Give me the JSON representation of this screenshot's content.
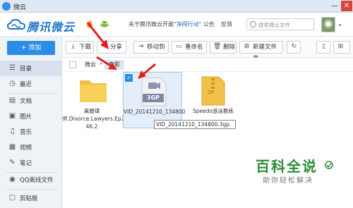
{
  "window": {
    "title": "微云",
    "minimize": "—",
    "close": "✕"
  },
  "header": {
    "logo_text": "腾讯微云",
    "notice_prefix": "关于腾讯微云开展",
    "notice_link": "\"净网行动\"",
    "notice_suffix": " 公告",
    "feedback": "反馈",
    "search_placeholder": "搜索微云文件"
  },
  "sidebar": {
    "add_label": "+ 添加",
    "items": [
      {
        "label": "目录",
        "icon": "directory-icon"
      },
      {
        "label": "最近",
        "icon": "clock-icon"
      },
      {
        "label": "文档",
        "icon": "document-icon"
      },
      {
        "label": "图片",
        "icon": "image-icon"
      },
      {
        "label": "音乐",
        "icon": "music-icon"
      },
      {
        "label": "视频",
        "icon": "video-icon"
      },
      {
        "label": "笔记",
        "icon": "note-icon"
      },
      {
        "label": "QQ离线文件",
        "icon": "qq-icon"
      },
      {
        "label": "剪贴板",
        "icon": "clipboard-icon"
      }
    ]
  },
  "toolbar": {
    "download": "下载",
    "share": "分享",
    "move_to": "移动到",
    "rename": "重命名",
    "delete": "删除",
    "new_folder": "新建文件夹"
  },
  "breadcrumb": [
    "微云",
    "电影"
  ],
  "files": [
    {
      "name": "离婚律师.Divorce.Lawyers.Ep25-46.2",
      "type": "folder"
    },
    {
      "name": "VID_20141210_134800",
      "type": "3gp",
      "type_label": "3GP",
      "selected": true
    },
    {
      "name": "Speedo游泳教练",
      "type": "zip",
      "type_label": "ZIP"
    }
  ],
  "tooltip": "VID_20141210_134800.3gp",
  "watermark": {
    "title": "百科全说",
    "subtitle": "助你轻松解决"
  },
  "colors": {
    "accent": "#2b8de5",
    "arrow": "#e02020",
    "watermark": "#2e8b3a"
  }
}
